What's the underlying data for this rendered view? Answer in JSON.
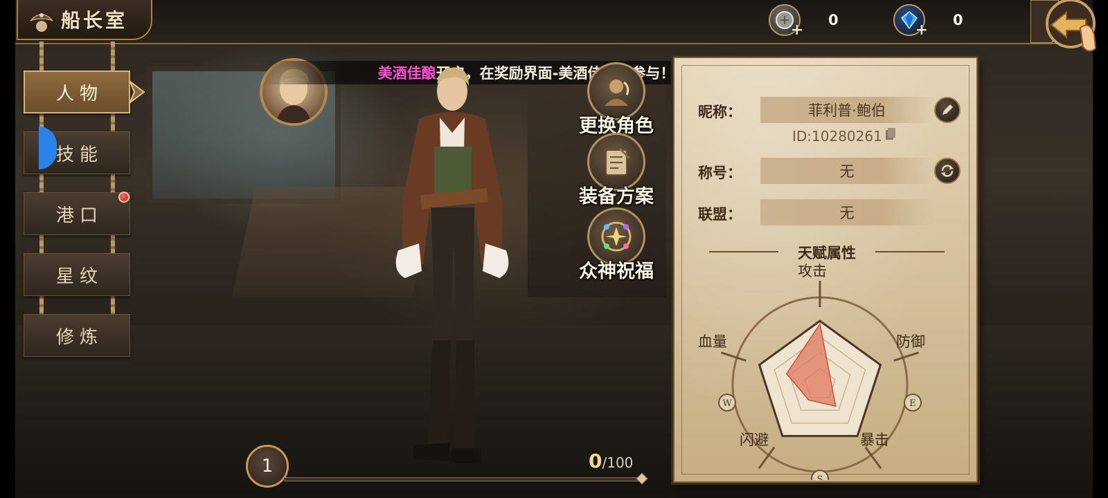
{
  "header": {
    "title": "船长室",
    "currencies": [
      {
        "icon": "silver-coin-icon",
        "amount": "0"
      },
      {
        "icon": "blue-gem-icon",
        "amount": "0"
      }
    ]
  },
  "menu": {
    "items": [
      {
        "label": "人物",
        "active": true
      },
      {
        "label": "技能",
        "active": false
      },
      {
        "label": "港口",
        "active": false,
        "badge": true
      },
      {
        "label": "星纹",
        "active": false
      },
      {
        "label": "修炼",
        "active": false
      }
    ]
  },
  "banner": {
    "highlight": "美酒佳酿",
    "rest": "开启，在奖励界面-美酒佳酿处参与！"
  },
  "actions": [
    {
      "label": "更换角色",
      "icon": "swap-character-icon"
    },
    {
      "label": "装备方案",
      "icon": "equipment-plan-icon"
    },
    {
      "label": "众神祝福",
      "icon": "gods-blessing-icon"
    }
  ],
  "level": {
    "value": "1",
    "xp_current": "0",
    "xp_max": "/100",
    "xp_fraction": 0
  },
  "profile": {
    "nickname_label": "昵称：",
    "nickname": "菲利普·鲍伯",
    "id_text": "ID:10280261",
    "title_label": "称号：",
    "title_value": "无",
    "alliance_label": "联盟：",
    "alliance_value": "无"
  },
  "talent": {
    "title": "天赋属性",
    "stats": [
      {
        "label": "攻击",
        "value": 0.95
      },
      {
        "label": "防御",
        "value": 0.18
      },
      {
        "label": "暴击",
        "value": 0.42
      },
      {
        "label": "闪避",
        "value": 0.3
      },
      {
        "label": "血量",
        "value": 0.55
      }
    ],
    "compass_letters": [
      "W",
      "E",
      "S"
    ]
  },
  "colors": {
    "banner_highlight": "#ff4fd8",
    "radar_fill": "#e07a5f",
    "menu_active": "#8f6b3e",
    "parchment": "#e4d4b6"
  }
}
